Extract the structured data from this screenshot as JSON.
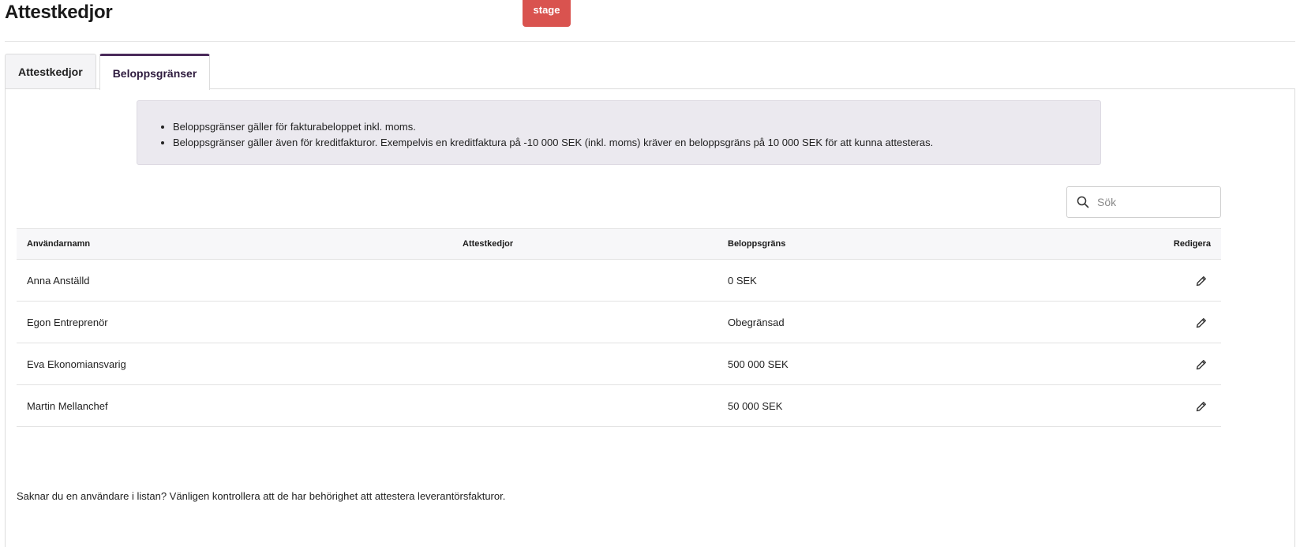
{
  "header": {
    "title": "Attestkedjor",
    "stage_label": "stage"
  },
  "tabs": [
    {
      "label": "Attestkedjor",
      "active": false
    },
    {
      "label": "Beloppsgränser",
      "active": true
    }
  ],
  "info": {
    "items": [
      "Beloppsgränser gäller för fakturabeloppet inkl. moms.",
      "Beloppsgränser gäller även för kreditfakturor. Exempelvis en kreditfaktura på -10 000 SEK (inkl. moms) kräver en beloppsgräns på 10 000 SEK för att kunna attesteras."
    ]
  },
  "search": {
    "placeholder": "Sök",
    "value": ""
  },
  "table": {
    "headers": {
      "name": "Användarnamn",
      "chains": "Attestkedjor",
      "limit": "Beloppsgräns",
      "edit": "Redigera"
    },
    "rows": [
      {
        "name": "Anna Anställd",
        "chains": "",
        "limit": "0 SEK"
      },
      {
        "name": "Egon Entreprenör",
        "chains": "",
        "limit": "Obegränsad"
      },
      {
        "name": "Eva Ekonomiansvarig",
        "chains": "",
        "limit": "500 000 SEK"
      },
      {
        "name": "Martin Mellanchef",
        "chains": "",
        "limit": "50 000 SEK"
      }
    ]
  },
  "footer": {
    "note": "Saknar du en användare i listan? Vänligen kontrollera att de har behörighet att attestera leverantörsfakturor."
  },
  "icons": {
    "search": "search-icon",
    "edit": "pencil-icon"
  },
  "colors": {
    "stage_badge": "#d9534f",
    "active_tab_accent": "#4a2a5a",
    "info_background": "#ebe9ef"
  }
}
